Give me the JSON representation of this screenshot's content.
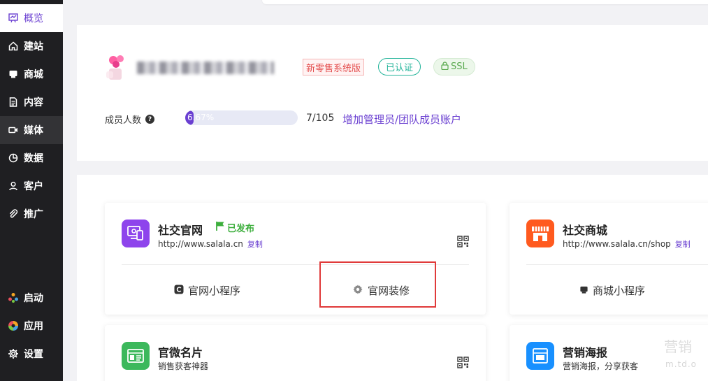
{
  "sidebar": {
    "items": [
      {
        "label": "概览",
        "icon": "overview-icon",
        "active": true
      },
      {
        "label": "建站",
        "icon": "home-icon"
      },
      {
        "label": "商城",
        "icon": "shop-icon"
      },
      {
        "label": "内容",
        "icon": "document-icon"
      },
      {
        "label": "媒体",
        "icon": "video-icon",
        "highlight": true
      },
      {
        "label": "数据",
        "icon": "pie-chart-icon"
      },
      {
        "label": "客户",
        "icon": "user-icon"
      },
      {
        "label": "推广",
        "icon": "paperclip-icon"
      },
      {
        "label": "启动",
        "icon": "launch-icon"
      },
      {
        "label": "应用",
        "icon": "apps-icon"
      },
      {
        "label": "设置",
        "icon": "gear-icon"
      }
    ]
  },
  "profile": {
    "badge_retail": "新零售系统版",
    "badge_verified": "已认证",
    "badge_ssl": "SSL",
    "member_label": "成员人数",
    "progress_text": "6.67%",
    "progress_fraction": 0.0667,
    "member_count": "7/105",
    "add_link": "增加管理员/团队成员账户"
  },
  "cards": {
    "site": {
      "title": "社交官网",
      "status": "已发布",
      "url": "http://www.salala.cn",
      "copy": "复制",
      "action_left": "官网小程序",
      "action_right": "官网装修"
    },
    "mall": {
      "title": "社交商城",
      "url": "http://www.salala.cn/shop",
      "copy": "复制",
      "action": "商城小程序"
    },
    "namecard": {
      "title": "官微名片",
      "subtitle": "销售获客神器"
    },
    "poster": {
      "title": "营销海报",
      "subtitle": "营销海报，分享获客"
    }
  },
  "colors": {
    "accent": "#6a3fd1",
    "sidebar_bg": "#1f1f22",
    "success": "#3cae3c",
    "highlight_box": "#e03a3a"
  },
  "watermark": {
    "line1": "营销",
    "line2": "m.td.o"
  }
}
